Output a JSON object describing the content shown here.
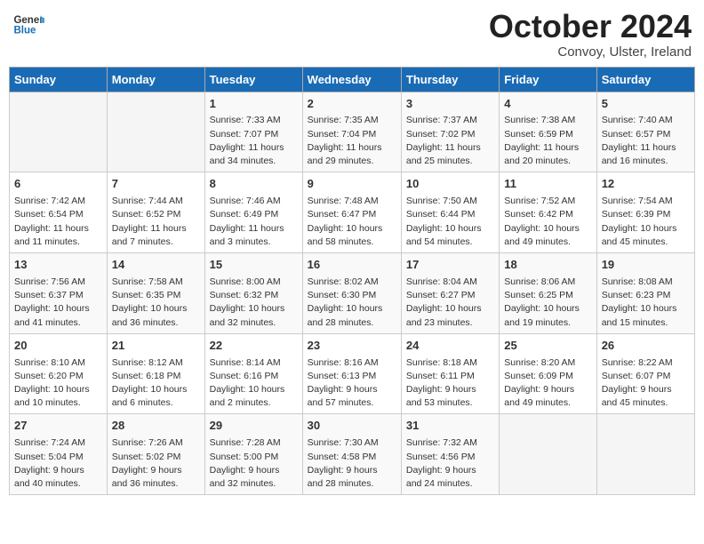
{
  "header": {
    "logo_line1": "General",
    "logo_line2": "Blue",
    "month": "October 2024",
    "location": "Convoy, Ulster, Ireland"
  },
  "days_of_week": [
    "Sunday",
    "Monday",
    "Tuesday",
    "Wednesday",
    "Thursday",
    "Friday",
    "Saturday"
  ],
  "weeks": [
    [
      {
        "day": "",
        "details": ""
      },
      {
        "day": "",
        "details": ""
      },
      {
        "day": "1",
        "details": "Sunrise: 7:33 AM\nSunset: 7:07 PM\nDaylight: 11 hours\nand 34 minutes."
      },
      {
        "day": "2",
        "details": "Sunrise: 7:35 AM\nSunset: 7:04 PM\nDaylight: 11 hours\nand 29 minutes."
      },
      {
        "day": "3",
        "details": "Sunrise: 7:37 AM\nSunset: 7:02 PM\nDaylight: 11 hours\nand 25 minutes."
      },
      {
        "day": "4",
        "details": "Sunrise: 7:38 AM\nSunset: 6:59 PM\nDaylight: 11 hours\nand 20 minutes."
      },
      {
        "day": "5",
        "details": "Sunrise: 7:40 AM\nSunset: 6:57 PM\nDaylight: 11 hours\nand 16 minutes."
      }
    ],
    [
      {
        "day": "6",
        "details": "Sunrise: 7:42 AM\nSunset: 6:54 PM\nDaylight: 11 hours\nand 11 minutes."
      },
      {
        "day": "7",
        "details": "Sunrise: 7:44 AM\nSunset: 6:52 PM\nDaylight: 11 hours\nand 7 minutes."
      },
      {
        "day": "8",
        "details": "Sunrise: 7:46 AM\nSunset: 6:49 PM\nDaylight: 11 hours\nand 3 minutes."
      },
      {
        "day": "9",
        "details": "Sunrise: 7:48 AM\nSunset: 6:47 PM\nDaylight: 10 hours\nand 58 minutes."
      },
      {
        "day": "10",
        "details": "Sunrise: 7:50 AM\nSunset: 6:44 PM\nDaylight: 10 hours\nand 54 minutes."
      },
      {
        "day": "11",
        "details": "Sunrise: 7:52 AM\nSunset: 6:42 PM\nDaylight: 10 hours\nand 49 minutes."
      },
      {
        "day": "12",
        "details": "Sunrise: 7:54 AM\nSunset: 6:39 PM\nDaylight: 10 hours\nand 45 minutes."
      }
    ],
    [
      {
        "day": "13",
        "details": "Sunrise: 7:56 AM\nSunset: 6:37 PM\nDaylight: 10 hours\nand 41 minutes."
      },
      {
        "day": "14",
        "details": "Sunrise: 7:58 AM\nSunset: 6:35 PM\nDaylight: 10 hours\nand 36 minutes."
      },
      {
        "day": "15",
        "details": "Sunrise: 8:00 AM\nSunset: 6:32 PM\nDaylight: 10 hours\nand 32 minutes."
      },
      {
        "day": "16",
        "details": "Sunrise: 8:02 AM\nSunset: 6:30 PM\nDaylight: 10 hours\nand 28 minutes."
      },
      {
        "day": "17",
        "details": "Sunrise: 8:04 AM\nSunset: 6:27 PM\nDaylight: 10 hours\nand 23 minutes."
      },
      {
        "day": "18",
        "details": "Sunrise: 8:06 AM\nSunset: 6:25 PM\nDaylight: 10 hours\nand 19 minutes."
      },
      {
        "day": "19",
        "details": "Sunrise: 8:08 AM\nSunset: 6:23 PM\nDaylight: 10 hours\nand 15 minutes."
      }
    ],
    [
      {
        "day": "20",
        "details": "Sunrise: 8:10 AM\nSunset: 6:20 PM\nDaylight: 10 hours\nand 10 minutes."
      },
      {
        "day": "21",
        "details": "Sunrise: 8:12 AM\nSunset: 6:18 PM\nDaylight: 10 hours\nand 6 minutes."
      },
      {
        "day": "22",
        "details": "Sunrise: 8:14 AM\nSunset: 6:16 PM\nDaylight: 10 hours\nand 2 minutes."
      },
      {
        "day": "23",
        "details": "Sunrise: 8:16 AM\nSunset: 6:13 PM\nDaylight: 9 hours\nand 57 minutes."
      },
      {
        "day": "24",
        "details": "Sunrise: 8:18 AM\nSunset: 6:11 PM\nDaylight: 9 hours\nand 53 minutes."
      },
      {
        "day": "25",
        "details": "Sunrise: 8:20 AM\nSunset: 6:09 PM\nDaylight: 9 hours\nand 49 minutes."
      },
      {
        "day": "26",
        "details": "Sunrise: 8:22 AM\nSunset: 6:07 PM\nDaylight: 9 hours\nand 45 minutes."
      }
    ],
    [
      {
        "day": "27",
        "details": "Sunrise: 7:24 AM\nSunset: 5:04 PM\nDaylight: 9 hours\nand 40 minutes."
      },
      {
        "day": "28",
        "details": "Sunrise: 7:26 AM\nSunset: 5:02 PM\nDaylight: 9 hours\nand 36 minutes."
      },
      {
        "day": "29",
        "details": "Sunrise: 7:28 AM\nSunset: 5:00 PM\nDaylight: 9 hours\nand 32 minutes."
      },
      {
        "day": "30",
        "details": "Sunrise: 7:30 AM\nSunset: 4:58 PM\nDaylight: 9 hours\nand 28 minutes."
      },
      {
        "day": "31",
        "details": "Sunrise: 7:32 AM\nSunset: 4:56 PM\nDaylight: 9 hours\nand 24 minutes."
      },
      {
        "day": "",
        "details": ""
      },
      {
        "day": "",
        "details": ""
      }
    ]
  ]
}
